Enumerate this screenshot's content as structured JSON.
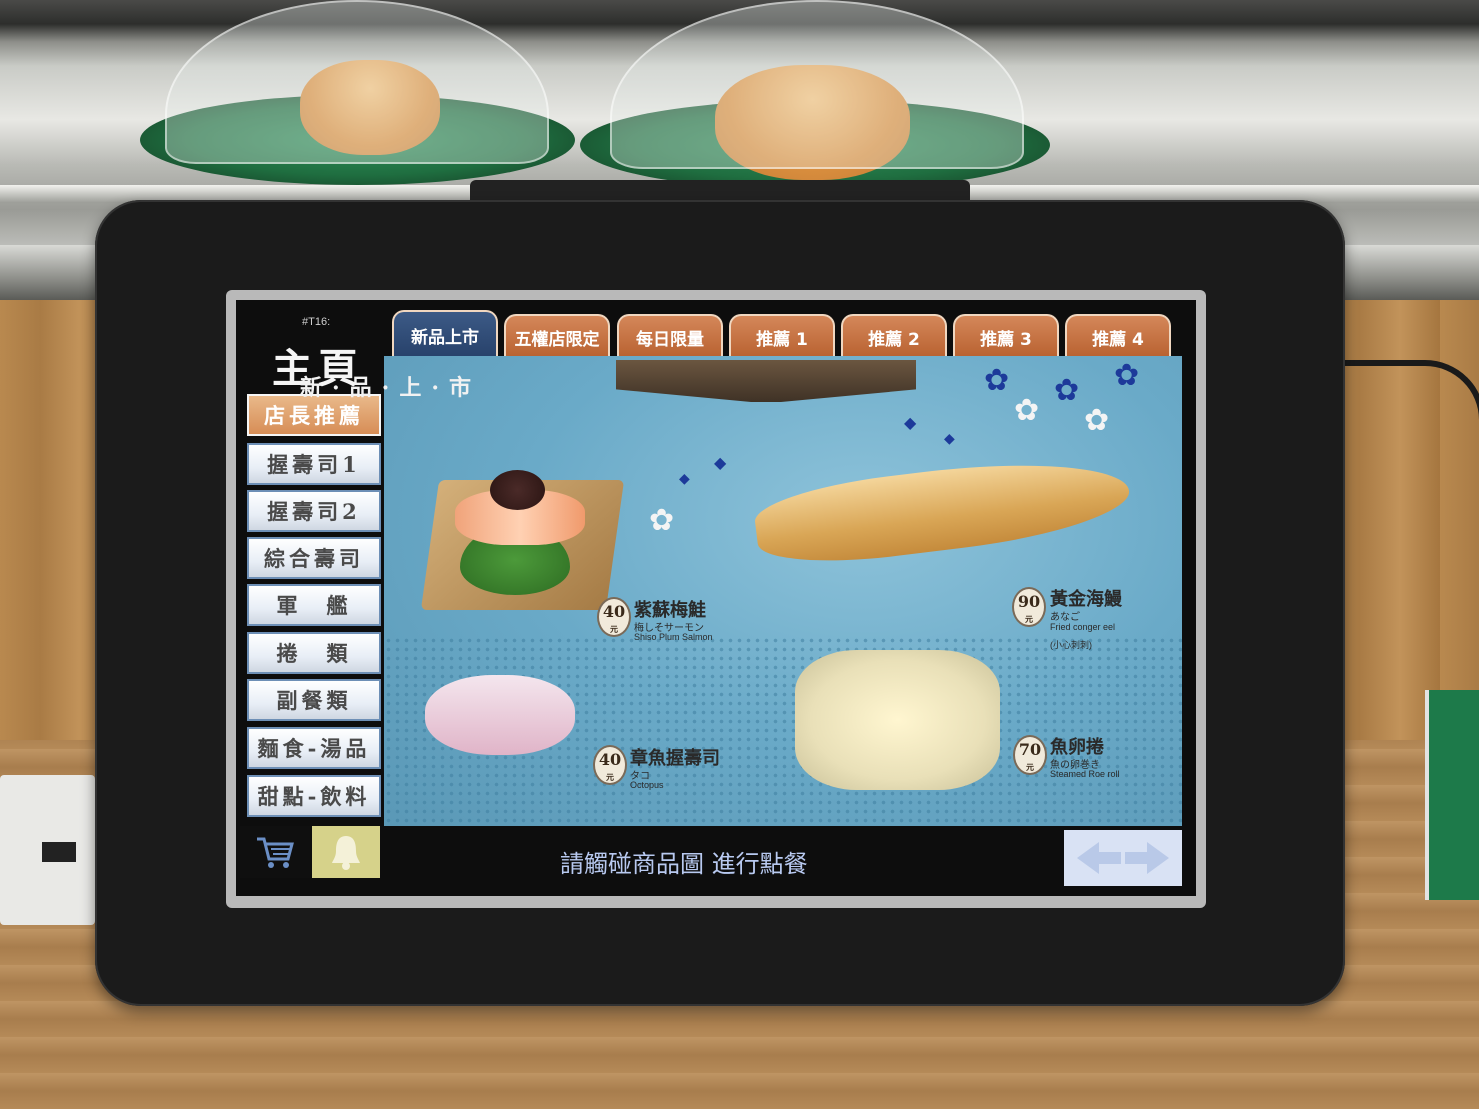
{
  "kiosk": {
    "table_id": "#T16:",
    "home_title": "主頁"
  },
  "sidebar": {
    "items": [
      {
        "label": "店長推薦",
        "active": true
      },
      {
        "label": "握壽司1"
      },
      {
        "label": "握壽司2"
      },
      {
        "label": "綜合壽司"
      },
      {
        "label": "軍　艦"
      },
      {
        "label": "捲　類"
      },
      {
        "label": "副餐類"
      },
      {
        "label": "麵食-湯品"
      },
      {
        "label": "甜點-飲料"
      }
    ],
    "cart_icon": "cart-icon",
    "bell_icon": "bell-icon"
  },
  "tabs": [
    {
      "label": "新品上市",
      "active": true
    },
    {
      "label": "五權店限定"
    },
    {
      "label": "每日限量"
    },
    {
      "label": "推薦 1"
    },
    {
      "label": "推薦 2"
    },
    {
      "label": "推薦 3"
    },
    {
      "label": "推薦 4"
    }
  ],
  "banner": "新·品·上·市",
  "products": [
    {
      "price": "40",
      "unit": "元",
      "name_cn": "紫蘇梅鮭",
      "name_jp": "梅しそサーモン",
      "name_en": "Shiso Plum Salmon",
      "note": ""
    },
    {
      "price": "90",
      "unit": "元",
      "name_cn": "黃金海鰻",
      "name_jp": "あなご",
      "name_en": "Fried conger eel",
      "note": "(小心刺刺)"
    },
    {
      "price": "40",
      "unit": "元",
      "name_cn": "章魚握壽司",
      "name_jp": "タコ",
      "name_en": "Octopus",
      "note": ""
    },
    {
      "price": "70",
      "unit": "元",
      "name_cn": "魚卵捲",
      "name_jp": "魚の卵巻き",
      "name_en": "Steamed Roe roll",
      "note": ""
    }
  ],
  "footer": {
    "hint": "請觸碰商品圖 進行點餐",
    "nav_icon": "left-right-arrows-icon"
  },
  "colors": {
    "tab_orange": "#c0693a",
    "tab_active": "#2f4b77",
    "sidebar_active": "#d78d56",
    "content_bg": "#6aaac8",
    "hint_text": "#b8c9f0"
  }
}
